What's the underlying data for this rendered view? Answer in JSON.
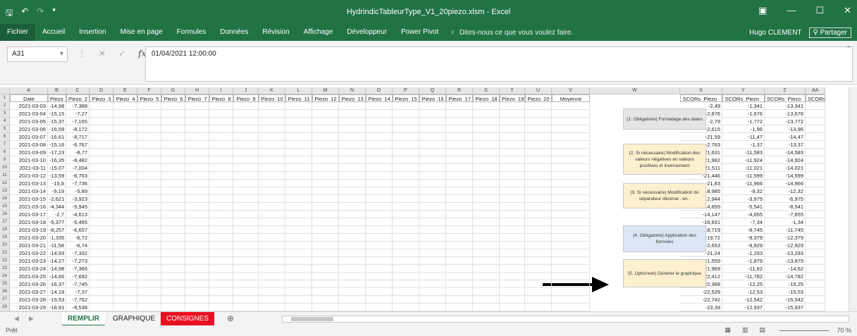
{
  "window": {
    "title": "HydrindicTableurType_V1_20piezo.xlsm - Excel",
    "controls": [
      "▣",
      "—",
      "☐",
      "✕"
    ]
  },
  "ribbon": {
    "tabs": [
      "Fichier",
      "Accueil",
      "Insertion",
      "Mise en page",
      "Formules",
      "Données",
      "Révision",
      "Affichage",
      "Développeur",
      "Power Pivot"
    ],
    "tell_me": "Dites-nous ce que vous voulez faire.",
    "user": "Hugo CLEMENT",
    "share": "Partager"
  },
  "formula_bar": {
    "name_box": "A31",
    "content": "01/04/2021 12:00:00"
  },
  "columns": [
    "A",
    "B",
    "C",
    "D",
    "E",
    "F",
    "G",
    "H",
    "I",
    "J",
    "K",
    "L",
    "M",
    "N",
    "O",
    "P",
    "Q",
    "R",
    "S",
    "T",
    "U",
    "V",
    "W",
    "X",
    "Y",
    "Z",
    "AA"
  ],
  "headers": [
    "Date",
    "Piezo_1",
    "Piezo_2",
    "Piezo_3",
    "Piezo_4",
    "Piezo_5",
    "Piezo_6",
    "Piezo_7",
    "Piezo_8",
    "Piezo_9",
    "Piezo_10",
    "Piezo_11",
    "Piezo_12",
    "Piezo_13",
    "Piezo_14",
    "Piezo_15",
    "Piezo_16",
    "Piezo_17",
    "Piezo_18",
    "Piezo_19",
    "Piezo_20",
    "Moyenne",
    "",
    "SCORs_Piezo_",
    "SCORs_Piezo_",
    "SCORs_Piezo_",
    "SCORs_I"
  ],
  "rows": [
    {
      "n": "2",
      "date": "2021-03-03",
      "p1": "-14,98",
      "p2": "-7,388",
      "x": "-2,49",
      "y": "-1,341",
      "z": "-13,341"
    },
    {
      "n": "3",
      "date": "2021-03-04",
      "p1": "-15,15",
      "p2": "-7,27",
      "x": "-2,876",
      "y": "-1,676",
      "z": "-13,676"
    },
    {
      "n": "4",
      "date": "2021-03-05",
      "p1": "-15,37",
      "p2": "-7,165",
      "x": "-2,79",
      "y": "-1,772",
      "z": "-13,772"
    },
    {
      "n": "5",
      "date": "2021-03-06",
      "p1": "-16,59",
      "p2": "-8,172",
      "x": "-2,615",
      "y": "-1,96",
      "z": "-13,96"
    },
    {
      "n": "6",
      "date": "2021-03-07",
      "p1": "-16,61",
      "p2": "-8,717",
      "x": "-21,59",
      "y": "-11,47",
      "z": "-14,47"
    },
    {
      "n": "7",
      "date": "2021-03-08",
      "p1": "-15,16",
      "p2": "-6,767",
      "x": "-2,763",
      "y": "-1,37",
      "z": "-13,37"
    },
    {
      "n": "8",
      "date": "2021-03-09",
      "p1": "-17,23",
      "p2": "-8,77",
      "x": "-21,631",
      "y": "-11,583",
      "z": "-14,583"
    },
    {
      "n": "9",
      "date": "2021-03-10",
      "p1": "-16,35",
      "p2": "-8,482",
      "x": "-21,982",
      "y": "-11,924",
      "z": "-14,924"
    },
    {
      "n": "10",
      "date": "2021-03-11",
      "p1": "-15,07",
      "p2": "-7,004",
      "x": "-21,511",
      "y": "-11,021",
      "z": "-14,021"
    },
    {
      "n": "11",
      "date": "2021-03-12",
      "p1": "-13,59",
      "p2": "-6,763",
      "x": "-21,446",
      "y": "-11,599",
      "z": "-14,599"
    },
    {
      "n": "12",
      "date": "2021-03-13",
      "p1": "-15,8",
      "p2": "-7,736",
      "x": "-21,83",
      "y": "-11,966",
      "z": "-14,966"
    },
    {
      "n": "13",
      "date": "2021-03-14",
      "p1": "-9,19",
      "p2": "-5,89",
      "x": "-18,985",
      "y": "-9,32",
      "z": "-12,32"
    },
    {
      "n": "14",
      "date": "2021-03-15",
      "p1": "-2,621",
      "p2": "-3,923",
      "x": "-12,944",
      "y": "-3,975",
      "z": "-6,975"
    },
    {
      "n": "15",
      "date": "2021-03-16",
      "p1": "-4,344",
      "p2": "-5,945",
      "x": "-14,655",
      "y": "-5,541",
      "z": "-8,541"
    },
    {
      "n": "16",
      "date": "2021-03-17",
      "p1": "-2,7",
      "p2": "-4,613",
      "x": "-14,147",
      "y": "-4,655",
      "z": "-7,655"
    },
    {
      "n": "17",
      "date": "2021-03-18",
      "p1": "-5,377",
      "p2": "-5,465",
      "x": "-16,831",
      "y": "-7,34",
      "z": "-1,34"
    },
    {
      "n": "18",
      "date": "2021-03-19",
      "p1": "-8,257",
      "p2": "-6,657",
      "x": "-18,719",
      "y": "-8,745",
      "z": "-11,745"
    },
    {
      "n": "19",
      "date": "2021-03-20",
      "p1": "-1,335",
      "p2": "-6,72",
      "x": "-19,72",
      "y": "-9,379",
      "z": "-12,379"
    },
    {
      "n": "20",
      "date": "2021-03-21",
      "p1": "-11,58",
      "p2": "-6,74",
      "x": "-2,653",
      "y": "-9,929",
      "z": "-12,929"
    },
    {
      "n": "21",
      "date": "2021-03-22",
      "p1": "-14,93",
      "p2": "-7,332",
      "x": "-21,24",
      "y": "-1,293",
      "z": "-13,293"
    },
    {
      "n": "22",
      "date": "2021-03-23",
      "p1": "-14,27",
      "p2": "-7,273",
      "x": "-21,559",
      "y": "-1,879",
      "z": "-13,879"
    },
    {
      "n": "23",
      "date": "2021-03-24",
      "p1": "-14,98",
      "p2": "-7,366",
      "x": "-21,969",
      "y": "-11,62",
      "z": "-14,62"
    },
    {
      "n": "24",
      "date": "2021-03-25",
      "p1": "-14,86",
      "p2": "-7,692",
      "x": "-22,412",
      "y": "-11,782",
      "z": "-14,782"
    },
    {
      "n": "25",
      "date": "2021-03-26",
      "p1": "-16,37",
      "p2": "-7,745",
      "x": "-22,368",
      "y": "-12,25",
      "z": "-15,25"
    },
    {
      "n": "26",
      "date": "2021-03-27",
      "p1": "-14,18",
      "p2": "-7,37",
      "x": "-22,539",
      "y": "-12,53",
      "z": "-15,53"
    },
    {
      "n": "27",
      "date": "2021-03-28",
      "p1": "-15,53",
      "p2": "-7,762",
      "x": "-22,742",
      "y": "-12,542",
      "z": "-15,542"
    },
    {
      "n": "28",
      "date": "2021-03-29",
      "p1": "-16,91",
      "p2": "-8,538",
      "x": "-23,39",
      "y": "-12,937",
      "z": "-15,937"
    }
  ],
  "buttons": [
    {
      "label": "(1. Obligatoire) Formatage des dates",
      "color": "grey"
    },
    {
      "label": "(2. Si nécessaire) Modification des valeurs négatives en valeurs positives et inversement",
      "color": "yellow"
    },
    {
      "label": "(3. Si nécessaire) Modification du séparateur décimal . en ,",
      "color": "yellow"
    },
    {
      "label": "(4. Obligatoire) Application des formules",
      "color": "blue"
    },
    {
      "label": "(5. Optionnel) Générer le graphique",
      "color": "yellow"
    }
  ],
  "sheets": {
    "remplir": "REMPLIR",
    "graphique": "GRAPHIQUE",
    "consignes": "CONSIGNES"
  },
  "status": {
    "ready": "Prêt",
    "zoom": "70 %"
  },
  "colors": {
    "excel_green": "#217346",
    "consignes_red": "#e81123",
    "button_grey": "#e5e5e5",
    "button_yellow": "#fdf0cf",
    "button_blue": "#dbe7f4"
  }
}
